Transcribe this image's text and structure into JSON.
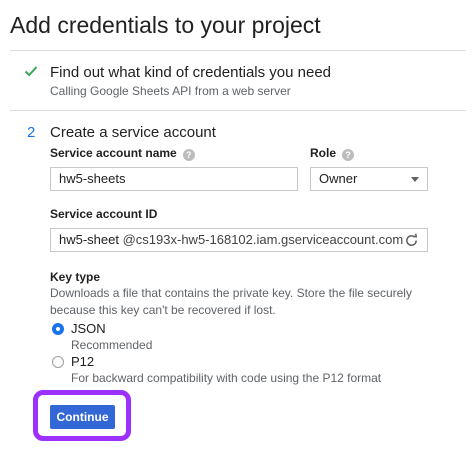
{
  "page": {
    "title": "Add credentials to your project"
  },
  "step1": {
    "title": "Find out what kind of credentials you need",
    "subtitle": "Calling Google Sheets API from a web server",
    "status_icon": "check-icon"
  },
  "step2": {
    "number": "2",
    "title": "Create a service account",
    "service_account_name": {
      "label": "Service account name",
      "value": "hw5-sheets"
    },
    "role": {
      "label": "Role",
      "selected": "Owner"
    },
    "service_account_id": {
      "label": "Service account ID",
      "value": "hw5-sheet",
      "suffix": "@cs193x-hw5-168102.iam.gserviceaccount.com"
    },
    "key_type": {
      "label": "Key type",
      "description_line1": "Downloads a file that contains the private key. Store the file securely",
      "description_line2": "because this key can't be recovered if lost.",
      "options": [
        {
          "label": "JSON",
          "sublabel": "Recommended",
          "selected": true
        },
        {
          "label": "P12",
          "sublabel": "For backward compatibility with code using the P12 format",
          "selected": false
        }
      ]
    },
    "continue_label": "Continue"
  },
  "colors": {
    "accent": "#1a73e8",
    "button": "#3367d6",
    "highlight": "#9b30ff",
    "check": "#34a853"
  }
}
